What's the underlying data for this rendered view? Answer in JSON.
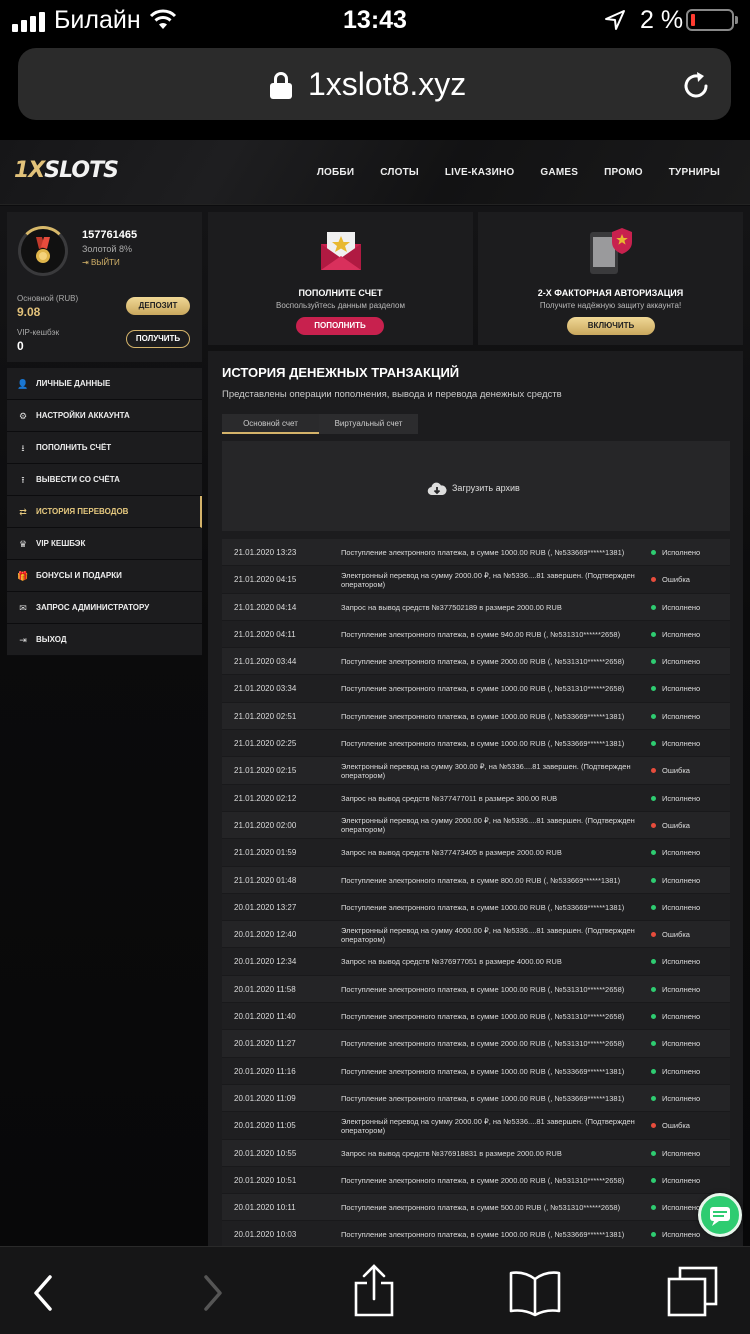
{
  "status_bar": {
    "carrier": "Билайн",
    "time": "13:43",
    "battery_percent": "2 %",
    "battery_level": 0.02,
    "battery_color": "#ff3b30"
  },
  "browser": {
    "url": "1xslot8.xyz"
  },
  "site": {
    "logo_part1": "1X",
    "logo_part2": "SLOTS",
    "nav": [
      "ЛОББИ",
      "СЛОТЫ",
      "LIVE-КАЗИНО",
      "GAMES",
      "ПРОМО",
      "ТУРНИРЫ"
    ],
    "accent": "#d4b36a"
  },
  "profile": {
    "user_id": "157761465",
    "level": "Золотой 8%",
    "logout_label": "ВЫЙТИ",
    "balance_label": "Основной (RUB)",
    "balance_value": "9.08",
    "vip_label": "VIP-кешбэк",
    "vip_value": "0",
    "deposit_button": "ДЕПОЗИТ",
    "get_button": "ПОЛУЧИТЬ"
  },
  "promo_cards": [
    {
      "title": "ПОПОЛНИТЕ СЧЕТ",
      "subtitle": "Воспользуйтесь данным разделом",
      "button": "ПОПОЛНИТЬ",
      "icon": "envelope-star-icon"
    },
    {
      "title": "2-Х ФАКТОРНАЯ АВТОРИЗАЦИЯ",
      "subtitle": "Получите надёжную защиту аккаунта!",
      "button": "ВКЛЮЧИТЬ",
      "icon": "phone-shield-icon"
    }
  ],
  "menu": [
    {
      "label": "ЛИЧНЫЕ ДАННЫЕ",
      "icon": "user-icon",
      "glyph": "👤"
    },
    {
      "label": "НАСТРОЙКИ АККАУНТА",
      "icon": "gears-icon",
      "glyph": "⚙"
    },
    {
      "label": "ПОПОЛНИТЬ СЧЁТ",
      "icon": "download-icon",
      "glyph": "⭳"
    },
    {
      "label": "ВЫВЕСТИ СО СЧЁТА",
      "icon": "upload-icon",
      "glyph": "⭱"
    },
    {
      "label": "ИСТОРИЯ ПЕРЕВОДОВ",
      "icon": "transfer-icon",
      "glyph": "⇄",
      "active": true
    },
    {
      "label": "VIP КЕШБЭК",
      "icon": "crown-icon",
      "glyph": "♛"
    },
    {
      "label": "БОНУСЫ И ПОДАРКИ",
      "icon": "gift-icon",
      "glyph": "🎁"
    },
    {
      "label": "ЗАПРОС АДМИНИСТРАТОРУ",
      "icon": "mail-icon",
      "glyph": "✉"
    },
    {
      "label": "ВЫХОД",
      "icon": "exit-icon",
      "glyph": "⇥"
    }
  ],
  "history": {
    "title": "ИСТОРИЯ ДЕНЕЖНЫХ ТРАНЗАКЦИЙ",
    "description": "Представлены операции пополнения, вывода и перевода денежных средств",
    "tabs": [
      "Основной счет",
      "Виртуальный счет"
    ],
    "archive_label": "Загрузить архив",
    "status_colors": {
      "ok": "#2ecc71",
      "err": "#e74c3c"
    },
    "rows": [
      {
        "date": "21.01.2020 13:23",
        "desc": "Поступление электронного платежа, в сумме 1000.00 RUB (, №533669******1381)",
        "status": "Исполнено",
        "ok": true
      },
      {
        "date": "21.01.2020 04:15",
        "desc": "Электронный перевод на сумму 2000.00 ₽, на №5336....81 завершен. (Подтвержден оператором)",
        "status": "Ошибка",
        "ok": false
      },
      {
        "date": "21.01.2020 04:14",
        "desc": "Запрос на вывод средств №377502189 в размере 2000.00 RUB",
        "status": "Исполнено",
        "ok": true
      },
      {
        "date": "21.01.2020 04:11",
        "desc": "Поступление электронного платежа, в сумме 940.00 RUB (, №531310******2658)",
        "status": "Исполнено",
        "ok": true
      },
      {
        "date": "21.01.2020 03:44",
        "desc": "Поступление электронного платежа, в сумме 2000.00 RUB (, №531310******2658)",
        "status": "Исполнено",
        "ok": true
      },
      {
        "date": "21.01.2020 03:34",
        "desc": "Поступление электронного платежа, в сумме 1000.00 RUB (, №531310******2658)",
        "status": "Исполнено",
        "ok": true
      },
      {
        "date": "21.01.2020 02:51",
        "desc": "Поступление электронного платежа, в сумме 1000.00 RUB (, №533669******1381)",
        "status": "Исполнено",
        "ok": true
      },
      {
        "date": "21.01.2020 02:25",
        "desc": "Поступление электронного платежа, в сумме 1000.00 RUB (, №533669******1381)",
        "status": "Исполнено",
        "ok": true
      },
      {
        "date": "21.01.2020 02:15",
        "desc": "Электронный перевод на сумму 300.00 ₽, на №5336....81 завершен. (Подтвержден оператором)",
        "status": "Ошибка",
        "ok": false
      },
      {
        "date": "21.01.2020 02:12",
        "desc": "Запрос на вывод средств №377477011 в размере 300.00 RUB",
        "status": "Исполнено",
        "ok": true
      },
      {
        "date": "21.01.2020 02:00",
        "desc": "Электронный перевод на сумму 2000.00 ₽, на №5336....81 завершен. (Подтвержден оператором)",
        "status": "Ошибка",
        "ok": false
      },
      {
        "date": "21.01.2020 01:59",
        "desc": "Запрос на вывод средств №377473405 в размере 2000.00 RUB",
        "status": "Исполнено",
        "ok": true
      },
      {
        "date": "21.01.2020 01:48",
        "desc": "Поступление электронного платежа, в сумме 800.00 RUB (, №533669******1381)",
        "status": "Исполнено",
        "ok": true
      },
      {
        "date": "20.01.2020 13:27",
        "desc": "Поступление электронного платежа, в сумме 1000.00 RUB (, №533669******1381)",
        "status": "Исполнено",
        "ok": true
      },
      {
        "date": "20.01.2020 12:40",
        "desc": "Электронный перевод на сумму 4000.00 ₽, на №5336....81 завершен. (Подтвержден оператором)",
        "status": "Ошибка",
        "ok": false
      },
      {
        "date": "20.01.2020 12:34",
        "desc": "Запрос на вывод средств №376977051 в размере 4000.00 RUB",
        "status": "Исполнено",
        "ok": true
      },
      {
        "date": "20.01.2020 11:58",
        "desc": "Поступление электронного платежа, в сумме 1000.00 RUB (, №531310******2658)",
        "status": "Исполнено",
        "ok": true
      },
      {
        "date": "20.01.2020 11:40",
        "desc": "Поступление электронного платежа, в сумме 1000.00 RUB (, №531310******2658)",
        "status": "Исполнено",
        "ok": true
      },
      {
        "date": "20.01.2020 11:27",
        "desc": "Поступление электронного платежа, в сумме 2000.00 RUB (, №531310******2658)",
        "status": "Исполнено",
        "ok": true
      },
      {
        "date": "20.01.2020 11:16",
        "desc": "Поступление электронного платежа, в сумме 1000.00 RUB (, №533669******1381)",
        "status": "Исполнено",
        "ok": true
      },
      {
        "date": "20.01.2020 11:09",
        "desc": "Поступление электронного платежа, в сумме 1000.00 RUB (, №533669******1381)",
        "status": "Исполнено",
        "ok": true
      },
      {
        "date": "20.01.2020 11:05",
        "desc": "Электронный перевод на сумму 2000.00 ₽, на №5336....81 завершен. (Подтвержден оператором)",
        "status": "Ошибка",
        "ok": false
      },
      {
        "date": "20.01.2020 10:55",
        "desc": "Запрос на вывод средств №376918831 в размере 2000.00 RUB",
        "status": "Исполнено",
        "ok": true
      },
      {
        "date": "20.01.2020 10:51",
        "desc": "Поступление электронного платежа, в сумме 2000.00 RUB (, №531310******2658)",
        "status": "Исполнено",
        "ok": true
      },
      {
        "date": "20.01.2020 10:11",
        "desc": "Поступление электронного платежа, в сумме 500.00 RUB (, №531310******2658)",
        "status": "Исполнено",
        "ok": true
      },
      {
        "date": "20.01.2020 10:03",
        "desc": "Поступление электронного платежа, в сумме 1000.00 RUB (, №533669******1381)",
        "status": "Исполнено",
        "ok": true
      }
    ]
  },
  "toolbar": {
    "icons": [
      "back-icon",
      "forward-icon",
      "share-icon",
      "bookmarks-icon",
      "tabs-icon"
    ]
  }
}
